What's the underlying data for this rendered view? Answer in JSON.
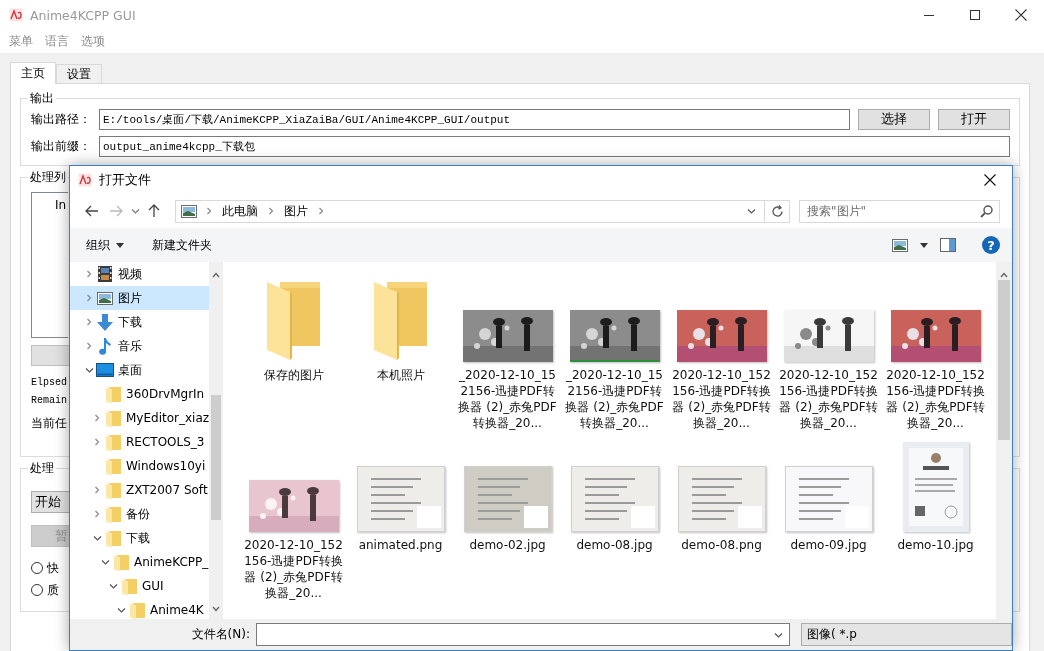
{
  "window": {
    "title": "Anime4KCPP GUI"
  },
  "menu": [
    "菜单",
    "语言",
    "选项"
  ],
  "tabs": [
    {
      "label": "主页",
      "selected": true
    },
    {
      "label": "设置",
      "selected": false
    }
  ],
  "output_group": {
    "title": "输出",
    "fields": [
      {
        "label": "输出路径：",
        "value": "E:/tools/桌面/下载/AnimeKCPP_XiaZaiBa/GUI/Anime4KCPP_GUI/output"
      },
      {
        "label": "输出前缀：",
        "value": "output_anime4kcpp_下载包"
      }
    ],
    "buttons": [
      "选择",
      "打开"
    ]
  },
  "list_group": {
    "title": "处理列",
    "column_1": "In",
    "status_lines": [
      "Elpsed",
      "Remain"
    ],
    "current_task": "当前任"
  },
  "process_group": {
    "title": "处理",
    "buttons": [
      {
        "label": "开始",
        "disabled": false
      },
      {
        "label": "暂",
        "disabled": true
      }
    ],
    "modes": [
      {
        "label": "快",
        "selected": false
      },
      {
        "label": "质",
        "selected": false
      }
    ]
  },
  "dialog": {
    "title": "打开文件",
    "forward_enabled": false,
    "breadcrumb": [
      "此电脑",
      "图片"
    ],
    "search": {
      "placeholder": "搜索\"图片\""
    },
    "toolbar": {
      "organize": "组织",
      "new_folder": "新建文件夹",
      "help": "?"
    },
    "nav_tree": [
      {
        "label": "视频",
        "kind": "video",
        "expandable": true,
        "expanded": false,
        "selected": false
      },
      {
        "label": "图片",
        "kind": "picture",
        "expandable": true,
        "expanded": false,
        "selected": true
      },
      {
        "label": "下载",
        "kind": "download",
        "expandable": true,
        "expanded": false,
        "selected": false
      },
      {
        "label": "音乐",
        "kind": "music",
        "expandable": true,
        "expanded": false,
        "selected": false
      },
      {
        "label": "桌面",
        "kind": "desktop",
        "expandable": true,
        "expanded": true,
        "selected": false,
        "children": [
          {
            "label": "360DrvMgrIn",
            "kind": "folder",
            "expandable": false,
            "selected": false
          },
          {
            "label": "MyEditor_xiaz",
            "kind": "folder",
            "expandable": true,
            "expanded": false,
            "selected": false
          },
          {
            "label": "RECTOOLS_3",
            "kind": "folder",
            "expandable": true,
            "expanded": false,
            "selected": false
          },
          {
            "label": "Windows10yi",
            "kind": "folder",
            "expandable": false,
            "selected": false
          },
          {
            "label": "ZXT2007 Soft",
            "kind": "folder",
            "expandable": true,
            "expanded": false,
            "selected": false
          },
          {
            "label": "备份",
            "kind": "folder",
            "expandable": true,
            "expanded": false,
            "selected": false
          },
          {
            "label": "下载",
            "kind": "folder",
            "expandable": true,
            "expanded": true,
            "selected": false,
            "children": [
              {
                "label": "AnimeKCPP_",
                "kind": "folder",
                "expandable": true,
                "expanded": true,
                "selected": false,
                "children": [
                  {
                    "label": "GUI",
                    "kind": "folder",
                    "expandable": true,
                    "expanded": true,
                    "selected": false,
                    "children": [
                      {
                        "label": "Anime4K",
                        "kind": "folder",
                        "expandable": true,
                        "expanded": true,
                        "selected": false
                      }
                    ]
                  }
                ]
              }
            ]
          }
        ]
      }
    ],
    "items": [
      {
        "kind": "folder",
        "caption": "保存的图片"
      },
      {
        "kind": "folder",
        "caption": "本机照片"
      },
      {
        "kind": "picture",
        "caption": "_2020-12-10_152156-迅捷PDF转换器 (2)_赤兔PDF转换器_20..."
      },
      {
        "kind": "picture",
        "caption": "_2020-12-10_152156-迅捷PDF转换器 (2)_赤兔PDF转换器_20..."
      },
      {
        "kind": "picture",
        "caption": "2020-12-10_152156-迅捷PDF转换器 (2)_赤兔PDF转换器_20..."
      },
      {
        "kind": "picture",
        "caption": "2020-12-10_152156-迅捷PDF转换器 (2)_赤兔PDF转换器_20..."
      },
      {
        "kind": "picture",
        "caption": "2020-12-10_152156-迅捷PDF转换器 (2)_赤兔PDF转换器_20..."
      },
      {
        "kind": "picture",
        "caption": "2020-12-10_152156-迅捷PDF转换器 (2)_赤兔PDF转换器_20..."
      },
      {
        "kind": "picture",
        "caption": "animated.png"
      },
      {
        "kind": "picture",
        "caption": "demo-02.jpg"
      },
      {
        "kind": "picture",
        "caption": "demo-08.jpg"
      },
      {
        "kind": "picture",
        "caption": "demo-08.png"
      },
      {
        "kind": "picture",
        "caption": "demo-09.jpg"
      },
      {
        "kind": "picture",
        "caption": "demo-10.jpg"
      }
    ],
    "file_name": {
      "label": "文件名(N):"
    },
    "file_type": "图像( *.p"
  }
}
